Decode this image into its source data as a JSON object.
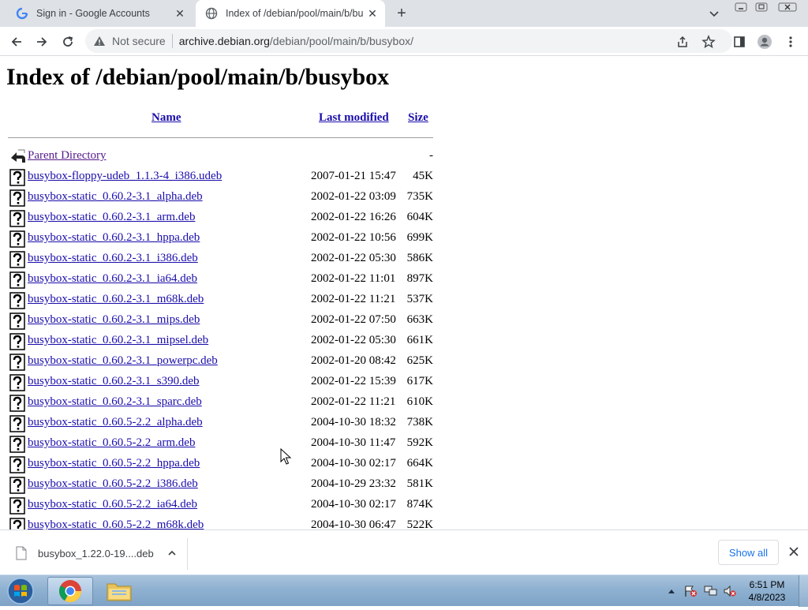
{
  "browser": {
    "tabs": [
      {
        "title": "Sign in - Google Accounts",
        "favicon": "google-g-icon",
        "active": false
      },
      {
        "title": "Index of /debian/pool/main/b/bu",
        "favicon": "globe-icon",
        "active": true
      }
    ],
    "security_label": "Not secure",
    "url_host": "archive.debian.org",
    "url_path": "/debian/pool/main/b/busybox/"
  },
  "page": {
    "title": "Index of /debian/pool/main/b/busybox",
    "columns": {
      "name": "Name",
      "modified": "Last modified",
      "size": "Size"
    },
    "parent": {
      "name": "Parent Directory",
      "size": "-"
    },
    "rows": [
      {
        "name": "busybox-floppy-udeb_1.1.3-4_i386.udeb",
        "modified": "2007-01-21 15:47",
        "size": "45K"
      },
      {
        "name": "busybox-static_0.60.2-3.1_alpha.deb",
        "modified": "2002-01-22 03:09",
        "size": "735K"
      },
      {
        "name": "busybox-static_0.60.2-3.1_arm.deb",
        "modified": "2002-01-22 16:26",
        "size": "604K"
      },
      {
        "name": "busybox-static_0.60.2-3.1_hppa.deb",
        "modified": "2002-01-22 10:56",
        "size": "699K"
      },
      {
        "name": "busybox-static_0.60.2-3.1_i386.deb",
        "modified": "2002-01-22 05:30",
        "size": "586K"
      },
      {
        "name": "busybox-static_0.60.2-3.1_ia64.deb",
        "modified": "2002-01-22 11:01",
        "size": "897K"
      },
      {
        "name": "busybox-static_0.60.2-3.1_m68k.deb",
        "modified": "2002-01-22 11:21",
        "size": "537K"
      },
      {
        "name": "busybox-static_0.60.2-3.1_mips.deb",
        "modified": "2002-01-22 07:50",
        "size": "663K"
      },
      {
        "name": "busybox-static_0.60.2-3.1_mipsel.deb",
        "modified": "2002-01-22 05:30",
        "size": "661K"
      },
      {
        "name": "busybox-static_0.60.2-3.1_powerpc.deb",
        "modified": "2002-01-20 08:42",
        "size": "625K"
      },
      {
        "name": "busybox-static_0.60.2-3.1_s390.deb",
        "modified": "2002-01-22 15:39",
        "size": "617K"
      },
      {
        "name": "busybox-static_0.60.2-3.1_sparc.deb",
        "modified": "2002-01-22 11:21",
        "size": "610K"
      },
      {
        "name": "busybox-static_0.60.5-2.2_alpha.deb",
        "modified": "2004-10-30 18:32",
        "size": "738K"
      },
      {
        "name": "busybox-static_0.60.5-2.2_arm.deb",
        "modified": "2004-10-30 11:47",
        "size": "592K"
      },
      {
        "name": "busybox-static_0.60.5-2.2_hppa.deb",
        "modified": "2004-10-30 02:17",
        "size": "664K"
      },
      {
        "name": "busybox-static_0.60.5-2.2_i386.deb",
        "modified": "2004-10-29 23:32",
        "size": "581K"
      },
      {
        "name": "busybox-static_0.60.5-2.2_ia64.deb",
        "modified": "2004-10-30 02:17",
        "size": "874K"
      },
      {
        "name": "busybox-static_0.60.5-2.2_m68k.deb",
        "modified": "2004-10-30 06:47",
        "size": "522K"
      }
    ]
  },
  "downloads": {
    "item_name": "busybox_1.22.0-19....deb",
    "show_all": "Show all"
  },
  "taskbar": {
    "time": "6:51 PM",
    "date": "4/8/2023",
    "apps": [
      "windows-start-icon",
      "chrome-icon",
      "file-explorer-icon"
    ]
  },
  "colors": {
    "link": "#1a0dab",
    "visited": "#551a8b",
    "tabbar": "#dee1e6"
  }
}
